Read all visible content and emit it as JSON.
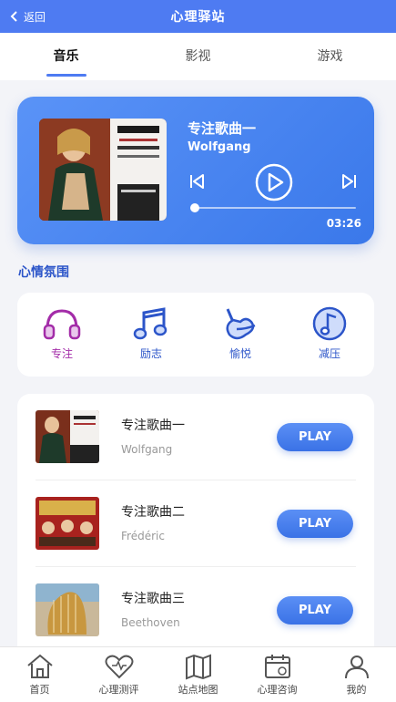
{
  "header": {
    "back_label": "返回",
    "title": "心理驿站"
  },
  "tabs": [
    {
      "label": "音乐",
      "active": true
    },
    {
      "label": "影视",
      "active": false
    },
    {
      "label": "游戏",
      "active": false
    }
  ],
  "player": {
    "title": "专注歌曲一",
    "artist": "Wolfgang",
    "time": "03:26",
    "progress": 0.02
  },
  "mood_section_title": "心情氛围",
  "moods": [
    {
      "label": "专注",
      "icon": "headphones-icon"
    },
    {
      "label": "励志",
      "icon": "music-note-icon"
    },
    {
      "label": "愉悦",
      "icon": "guitar-icon"
    },
    {
      "label": "减压",
      "icon": "note-circle-icon"
    }
  ],
  "songs": [
    {
      "name": "专注歌曲一",
      "artist": "Wolfgang",
      "button": "PLAY"
    },
    {
      "name": "专注歌曲二",
      "artist": "Frédéric",
      "button": "PLAY"
    },
    {
      "name": "专注歌曲三",
      "artist": "Beethoven",
      "button": "PLAY"
    }
  ],
  "bottom_nav": [
    {
      "label": "首页",
      "icon": "home-icon"
    },
    {
      "label": "心理测评",
      "icon": "heart-icon"
    },
    {
      "label": "站点地图",
      "icon": "map-icon"
    },
    {
      "label": "心理咨询",
      "icon": "calendar-icon"
    },
    {
      "label": "我的",
      "icon": "user-icon"
    }
  ],
  "colors": {
    "primary": "#4e7bf2",
    "accent_purple": "#a32ca8",
    "text_blue": "#2c55c9"
  }
}
